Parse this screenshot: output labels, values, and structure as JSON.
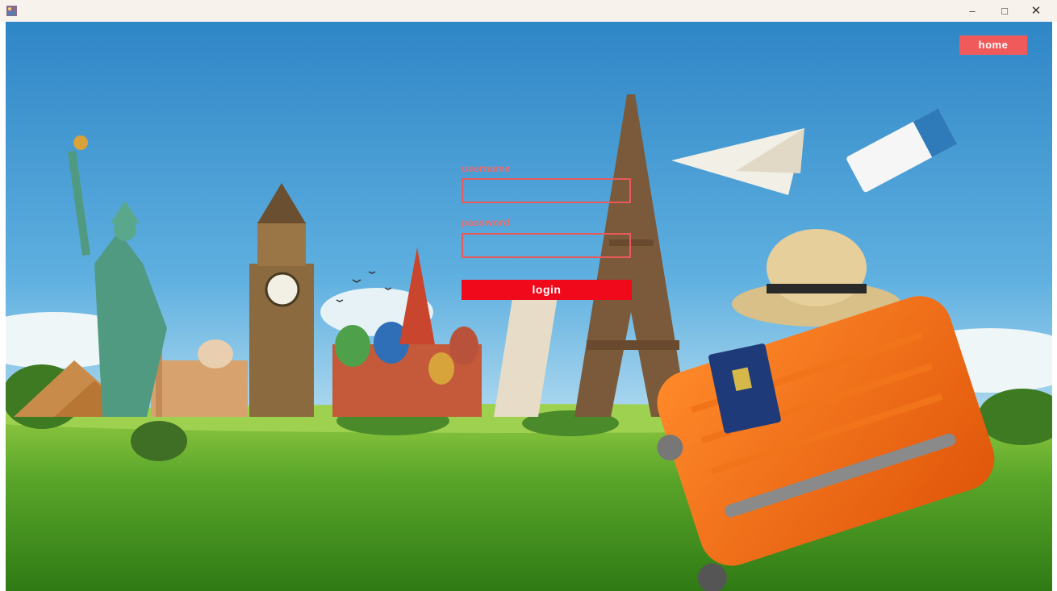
{
  "window": {
    "minimize_glyph": "–",
    "maximize_glyph": "□",
    "close_glyph": "✕"
  },
  "nav": {
    "home_label": "home"
  },
  "form": {
    "username_label": "username",
    "username_value": "",
    "password_label": "password",
    "password_value": "",
    "login_label": "login"
  },
  "colors": {
    "accent": "#f05a5a",
    "login_button": "#f0081b",
    "field_border": "#e85a5a",
    "title_bar": "#f7f2ec"
  },
  "icons": [
    "app-icon",
    "minimize-icon",
    "maximize-icon",
    "close-icon"
  ]
}
